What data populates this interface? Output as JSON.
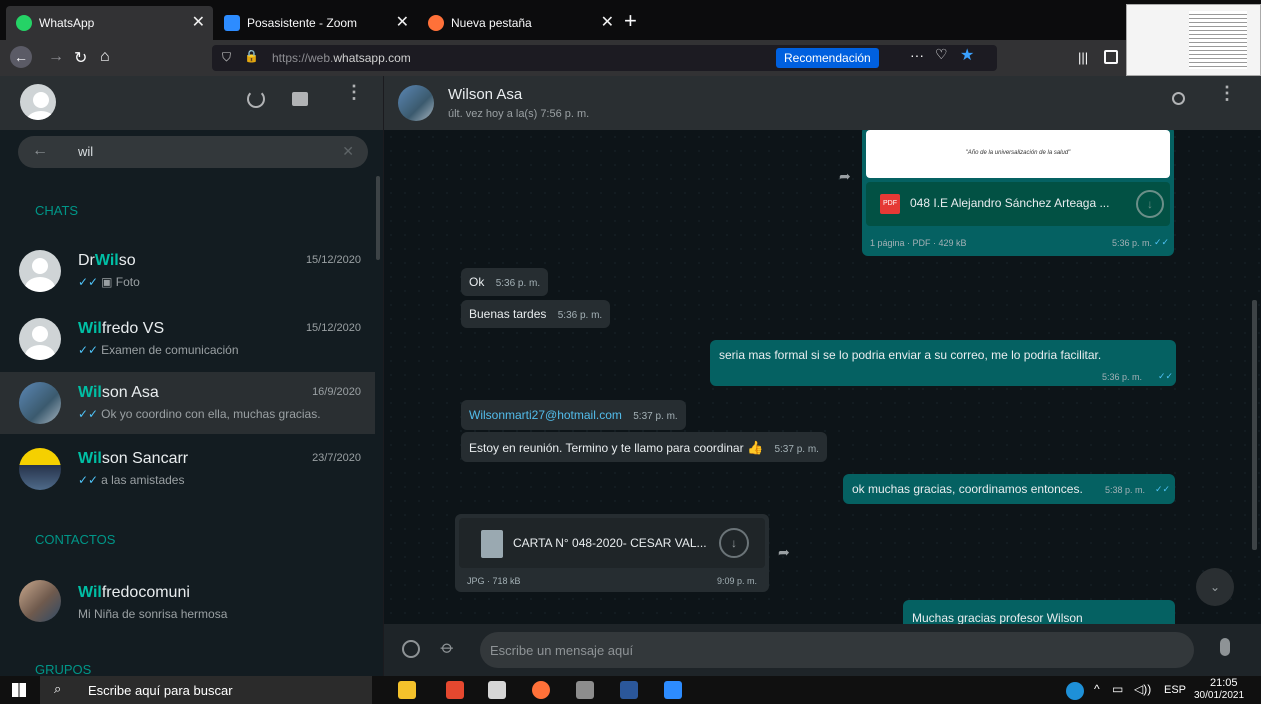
{
  "browser": {
    "tabs": [
      {
        "title": "WhatsApp",
        "close": "✕",
        "color": "#25d366"
      },
      {
        "title": "Posasistente - Zoom",
        "close": "✕",
        "color": "#2d8cff"
      },
      {
        "title": "Nueva pestaña",
        "close": "✕",
        "color": "#ff7139"
      }
    ],
    "new_tab": "+",
    "url_dim": "https://web.",
    "url_main": "whatsapp.com",
    "recommendation": "Recomendación",
    "more": "···"
  },
  "search": {
    "query": "wil"
  },
  "sections": {
    "chats": "CHATS",
    "contacts": "CONTACTOS",
    "groups": "GRUPOS"
  },
  "chats": [
    {
      "hl": "Wil",
      "name_pre": "Dr",
      "name_post": "so",
      "date": "15/12/2020",
      "msg": "Foto"
    },
    {
      "hl": "Wil",
      "name_pre": "",
      "name_post": "fredo VS",
      "date": "15/12/2020",
      "msg": "Examen de comunicación"
    },
    {
      "hl": "Wil",
      "name_pre": "",
      "name_post": "son Asa",
      "date": "16/9/2020",
      "msg": "Ok yo coordino con ella, muchas gracias."
    },
    {
      "hl": "Wil",
      "name_pre": "",
      "name_post": "son Sancarr",
      "date": "23/7/2020",
      "msg": "a las amistades"
    }
  ],
  "contact": {
    "hl": "Wil",
    "name_post": "fredocomuni",
    "status": "Mi Niña de sonrisa hermosa"
  },
  "conversation": {
    "name": "Wilson Asa",
    "last_seen": "últ. vez hoy a la(s) 7:56 p. m.",
    "doc_preview": "\"Año de la universalización de la salud\"",
    "doc_name": "048 I.E Alejandro Sánchez Arteaga ...",
    "doc_meta": "1 página · PDF · 429 kB",
    "doc_time": "5:36 p. m.",
    "messages": [
      {
        "text": "Ok",
        "time": "5:36 p. m."
      },
      {
        "text": "Buenas tardes",
        "time": "5:36 p. m."
      },
      {
        "text": "seria mas formal si se lo podria enviar a su correo, me lo podria facilitar.",
        "time": "5:36 p. m."
      },
      {
        "text": "Wilsonmarti27@hotmail.com",
        "time": "5:37 p. m."
      },
      {
        "text": "Estoy en reunión. Termino y te llamo para coordinar",
        "time": "5:37 p. m."
      },
      {
        "text": "ok muchas gracias, coordinamos entonces.",
        "time": "5:38 p. m."
      }
    ],
    "file_name": "CARTA N° 048-2020- CESAR VAL...",
    "file_meta": "JPG · 718 kB",
    "file_time": "9:09 p. m.",
    "partial": "Muchas gracias profesor Wilson"
  },
  "composer": {
    "placeholder": "Escribe un mensaje aquí"
  },
  "taskbar": {
    "search": "Escribe aquí para buscar",
    "lang": "ESP",
    "time": "21:05",
    "date": "30/01/2021"
  }
}
